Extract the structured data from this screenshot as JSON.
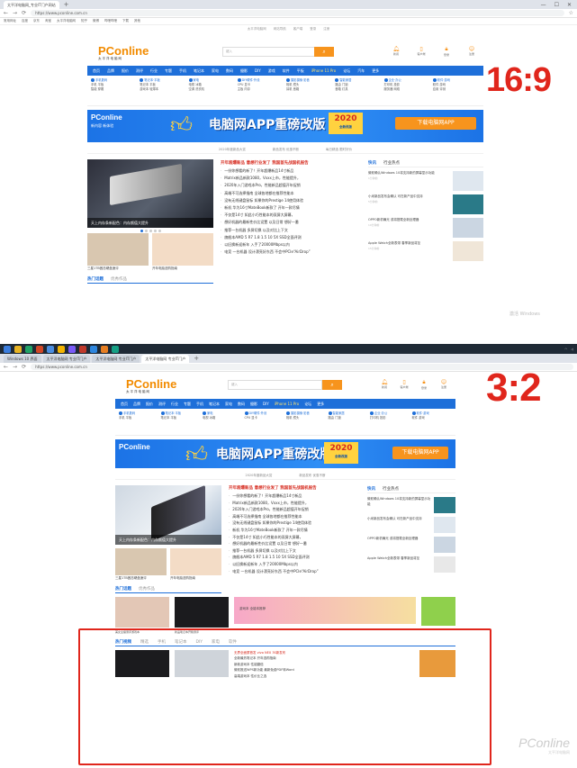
{
  "browser": {
    "tab_active": "太平洋电脑网_专业IT门户网站",
    "tabs_taskbar": [
      "Windows 10 界面",
      "太平洋电脑网 专业IT门户",
      "太平洋电脑网 专业IT门户",
      "太平洋电脑网 专业IT门户"
    ],
    "url": "https://www.pconline.com.cn",
    "bookmarks": [
      "常用网址",
      "百度",
      "京东",
      "淘宝",
      "太平洋电脑网",
      "知乎",
      "微博",
      "哔哩哔哩",
      "下载",
      "其他"
    ]
  },
  "site": {
    "top_links": [
      "太平洋电脑网",
      "网站导航",
      "客户端",
      "登录",
      "注册"
    ],
    "logo_main": "PConline",
    "logo_sub": "太平洋电脑网",
    "search_placeholder": "键入",
    "header_icons": [
      {
        "icon": "bell-icon",
        "label": "新闻"
      },
      {
        "icon": "phone-icon",
        "label": "客户端"
      },
      {
        "icon": "lock-icon",
        "label": "登录"
      },
      {
        "icon": "user-icon",
        "label": "注册"
      }
    ],
    "nav": [
      "首页",
      "品牌",
      "报价",
      "测评",
      "行业",
      "专题",
      "手机",
      "笔记本",
      "家电",
      "数码",
      "摄影",
      "DIY",
      "游戏",
      "软件",
      "平板",
      "办公",
      "iPhone 11 Pro",
      "网络",
      "论坛",
      "汽车",
      "更多"
    ],
    "channels": [
      {
        "title": "手机数码",
        "items": [
          "手机",
          "平板",
          "智能",
          "穿戴"
        ]
      },
      {
        "title": "笔记本·平板",
        "items": [
          "笔记本",
          "平板",
          "游戏本",
          "轻薄本"
        ]
      },
      {
        "title": "家电",
        "items": [
          "电视",
          "冰箱",
          "空调",
          "洗衣机"
        ]
      },
      {
        "title": "DIY硬件·外设",
        "items": [
          "CPU",
          "显卡",
          "主板",
          "内存"
        ]
      },
      {
        "title": "摄影摄像·影音",
        "items": [
          "相机",
          "镜头",
          "耳机",
          "音箱"
        ]
      },
      {
        "title": "智能家居",
        "items": [
          "路由",
          "门锁",
          "音箱",
          "灯具"
        ]
      },
      {
        "title": "企业·办公",
        "items": [
          "打印机",
          "投影",
          "服务器",
          "网络"
        ]
      },
      {
        "title": "软件·游戏",
        "items": [
          "软件",
          "游戏",
          "应用",
          "评测"
        ]
      }
    ],
    "banner": {
      "brand": "PConline",
      "title": "电脑网APP重磅改版",
      "sub": "新内容 新体验",
      "badge_year": "2020",
      "badge_sub": "全新改版",
      "download": "下载电脑网APP"
    },
    "ad_line": [
      "2020年度新品大赏",
      "新品发布 优惠不断",
      "每日精选 限时好价"
    ],
    "hero_caption": "天上内存条新配色：内存颜值大提升",
    "thumbs": [
      "三星1TB固态硬盘速评",
      "开年电脑选购指南"
    ],
    "sec_tabs": [
      "热门话题",
      "优秀作品"
    ],
    "headline": "开年超爆新品 意想行业发了 我国首先战国机报告",
    "news": [
      "一份你想看的新了！开年超爆新品14寸新品",
      "Matrix新品新款1080，Vxxx上市，性能提升，",
      "2020年入门游戏本Pro，性能新品超值开年促销",
      "高端不可选择指南 全球各地都在推荐性能本",
      "没有无线键盘鼠标 如果你的Prestige 14使用体验",
      "新机 华为16寸MateBook新款了 开年一款尽情",
      "不仅是14寸 如此小巧性能本的双屏大屏幕，",
      "想好机器的最新性价比设置 以及日常 想好一番",
      "推荐一台机器 多屏切换 以及对比上下文",
      "旗舰本AMD 5 R7 1.8 1.5 10 5X SSD全面评测",
      "以旧换新迎新年 入手了20000Mbps以内",
      "电竞 一台机器 设计漂亮好东西 不会中PCIe“AirDrop”"
    ],
    "quick_tabs": [
      "快讯",
      "行业热点"
    ],
    "quick_items": [
      {
        "text": "微软确认Windows 10将支持新的屏幕显示功能",
        "time": "1分钟前"
      },
      {
        "text": "小米新品发布会确认 可在新产品中支持",
        "time": "5分钟前"
      },
      {
        "text": "OPPO新机曝光 或将搭载全新处理器",
        "time": "10分钟前"
      },
      {
        "text": "Apple Watch全新表带 春季新品将至",
        "time": "15分钟前"
      }
    ],
    "windows_watermark": "激活 Windows",
    "lower_tabs": [
      "热门视频",
      "精选",
      "手机",
      "笔记本",
      "DIY",
      "家电",
      "软件"
    ],
    "lower_cards": [
      "美女主播测评游戏本",
      "新品笔记本开箱测评"
    ],
    "lower_news": [
      "无界全面屏首发 vivo NEX 3S新发布",
      "全新最热笔记本 开年选购指南",
      "新款游戏本 性能翻倍",
      "微软推送WPS新功能 最新免费PDF转Word",
      "高端游戏本 性价比之选"
    ],
    "promo_label": "游戏本 全能本推荐",
    "watermark_logo": "PConline",
    "watermark_sub": "太平洋电脑网"
  },
  "labels": {
    "top_ratio": "16:9",
    "bottom_ratio": "3:2"
  },
  "colors": {
    "nav_blue": "#1e6fd9",
    "accent_orange": "#f7941d",
    "highlight_red": "#e0261c"
  }
}
